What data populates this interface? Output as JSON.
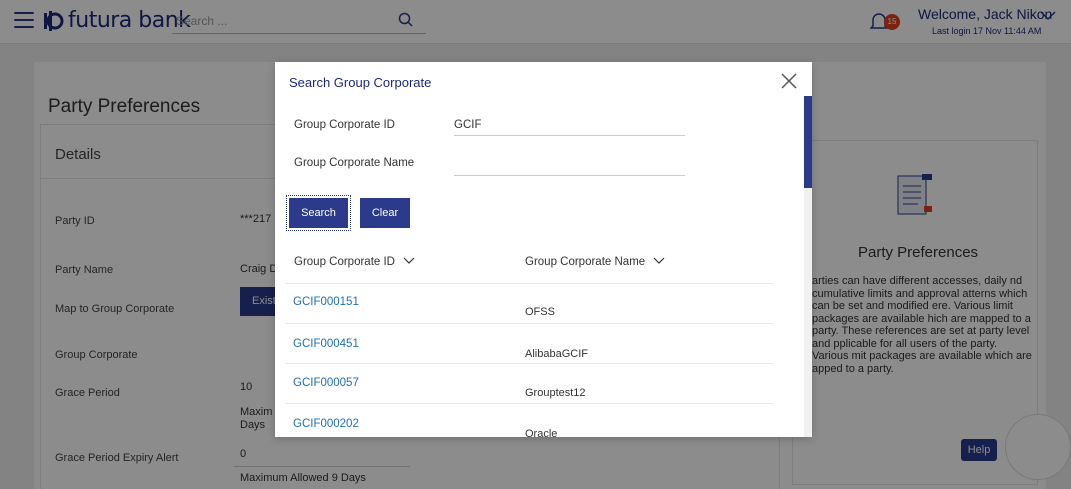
{
  "topbar": {
    "brand": "futura bank",
    "search_placeholder": "Search ...",
    "notification_count": "15",
    "welcome": "Welcome, Jack Nikon",
    "last_login": "Last login 17 Nov 11:44 AM"
  },
  "page": {
    "title": "Party Preferences",
    "details_heading": "Details",
    "fields": [
      {
        "label": "Party ID",
        "value": "***217"
      },
      {
        "label": "Party Name",
        "value": "Craig D"
      },
      {
        "label": "Map to Group Corporate",
        "value": "Exist"
      },
      {
        "label": "Group Corporate",
        "value": ""
      },
      {
        "label": "Grace Period",
        "value": "10"
      },
      {
        "label": "Grace Period Expiry Alert",
        "value": "0"
      }
    ],
    "grace_period_note": "Maxim Days",
    "grace_alert_note": "Maximum Allowed 9 Days"
  },
  "help_panel": {
    "title": "Party Preferences",
    "text": "arties can have different accesses, daily nd cumulative limits and approval atterns which can be set and modified ere. Various limit packages are available hich are mapped to a party. These references are set at party level and pplicable for all users of the party. Various mit packages are available which are apped to a party.",
    "help_button": "Help"
  },
  "modal": {
    "title": "Search Group Corporate",
    "fields": {
      "group_corporate_id_label": "Group Corporate ID",
      "group_corporate_id_value": "GCIF",
      "group_corporate_name_label": "Group Corporate Name",
      "group_corporate_name_value": ""
    },
    "buttons": {
      "search": "Search",
      "clear": "Clear"
    },
    "table": {
      "headers": [
        "Group Corporate ID",
        "Group Corporate Name"
      ],
      "rows": [
        {
          "id": "GCIF000151",
          "name": "OFSS"
        },
        {
          "id": "GCIF000451",
          "name": "AlibabaGCIF"
        },
        {
          "id": "GCIF000057",
          "name": "Grouptest12"
        },
        {
          "id": "GCIF000202",
          "name": "Oracle"
        }
      ]
    }
  },
  "colors": {
    "primary": "#2b3a8b",
    "brand_text": "#1d2a78",
    "link": "#1f6fb5",
    "badge": "#e2401c"
  }
}
